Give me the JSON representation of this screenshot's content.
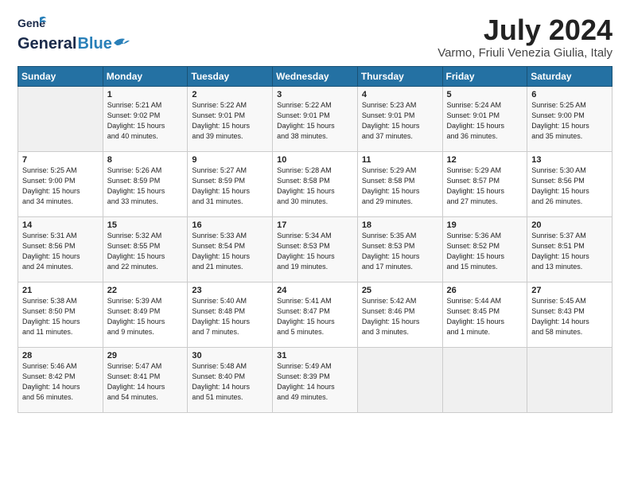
{
  "header": {
    "logo_general": "General",
    "logo_blue": "Blue",
    "title": "July 2024",
    "location": "Varmo, Friuli Venezia Giulia, Italy"
  },
  "days_of_week": [
    "Sunday",
    "Monday",
    "Tuesday",
    "Wednesday",
    "Thursday",
    "Friday",
    "Saturday"
  ],
  "weeks": [
    [
      {
        "day": "",
        "info": ""
      },
      {
        "day": "1",
        "info": "Sunrise: 5:21 AM\nSunset: 9:02 PM\nDaylight: 15 hours\nand 40 minutes."
      },
      {
        "day": "2",
        "info": "Sunrise: 5:22 AM\nSunset: 9:01 PM\nDaylight: 15 hours\nand 39 minutes."
      },
      {
        "day": "3",
        "info": "Sunrise: 5:22 AM\nSunset: 9:01 PM\nDaylight: 15 hours\nand 38 minutes."
      },
      {
        "day": "4",
        "info": "Sunrise: 5:23 AM\nSunset: 9:01 PM\nDaylight: 15 hours\nand 37 minutes."
      },
      {
        "day": "5",
        "info": "Sunrise: 5:24 AM\nSunset: 9:01 PM\nDaylight: 15 hours\nand 36 minutes."
      },
      {
        "day": "6",
        "info": "Sunrise: 5:25 AM\nSunset: 9:00 PM\nDaylight: 15 hours\nand 35 minutes."
      }
    ],
    [
      {
        "day": "7",
        "info": "Sunrise: 5:25 AM\nSunset: 9:00 PM\nDaylight: 15 hours\nand 34 minutes."
      },
      {
        "day": "8",
        "info": "Sunrise: 5:26 AM\nSunset: 8:59 PM\nDaylight: 15 hours\nand 33 minutes."
      },
      {
        "day": "9",
        "info": "Sunrise: 5:27 AM\nSunset: 8:59 PM\nDaylight: 15 hours\nand 31 minutes."
      },
      {
        "day": "10",
        "info": "Sunrise: 5:28 AM\nSunset: 8:58 PM\nDaylight: 15 hours\nand 30 minutes."
      },
      {
        "day": "11",
        "info": "Sunrise: 5:29 AM\nSunset: 8:58 PM\nDaylight: 15 hours\nand 29 minutes."
      },
      {
        "day": "12",
        "info": "Sunrise: 5:29 AM\nSunset: 8:57 PM\nDaylight: 15 hours\nand 27 minutes."
      },
      {
        "day": "13",
        "info": "Sunrise: 5:30 AM\nSunset: 8:56 PM\nDaylight: 15 hours\nand 26 minutes."
      }
    ],
    [
      {
        "day": "14",
        "info": "Sunrise: 5:31 AM\nSunset: 8:56 PM\nDaylight: 15 hours\nand 24 minutes."
      },
      {
        "day": "15",
        "info": "Sunrise: 5:32 AM\nSunset: 8:55 PM\nDaylight: 15 hours\nand 22 minutes."
      },
      {
        "day": "16",
        "info": "Sunrise: 5:33 AM\nSunset: 8:54 PM\nDaylight: 15 hours\nand 21 minutes."
      },
      {
        "day": "17",
        "info": "Sunrise: 5:34 AM\nSunset: 8:53 PM\nDaylight: 15 hours\nand 19 minutes."
      },
      {
        "day": "18",
        "info": "Sunrise: 5:35 AM\nSunset: 8:53 PM\nDaylight: 15 hours\nand 17 minutes."
      },
      {
        "day": "19",
        "info": "Sunrise: 5:36 AM\nSunset: 8:52 PM\nDaylight: 15 hours\nand 15 minutes."
      },
      {
        "day": "20",
        "info": "Sunrise: 5:37 AM\nSunset: 8:51 PM\nDaylight: 15 hours\nand 13 minutes."
      }
    ],
    [
      {
        "day": "21",
        "info": "Sunrise: 5:38 AM\nSunset: 8:50 PM\nDaylight: 15 hours\nand 11 minutes."
      },
      {
        "day": "22",
        "info": "Sunrise: 5:39 AM\nSunset: 8:49 PM\nDaylight: 15 hours\nand 9 minutes."
      },
      {
        "day": "23",
        "info": "Sunrise: 5:40 AM\nSunset: 8:48 PM\nDaylight: 15 hours\nand 7 minutes."
      },
      {
        "day": "24",
        "info": "Sunrise: 5:41 AM\nSunset: 8:47 PM\nDaylight: 15 hours\nand 5 minutes."
      },
      {
        "day": "25",
        "info": "Sunrise: 5:42 AM\nSunset: 8:46 PM\nDaylight: 15 hours\nand 3 minutes."
      },
      {
        "day": "26",
        "info": "Sunrise: 5:44 AM\nSunset: 8:45 PM\nDaylight: 15 hours\nand 1 minute."
      },
      {
        "day": "27",
        "info": "Sunrise: 5:45 AM\nSunset: 8:43 PM\nDaylight: 14 hours\nand 58 minutes."
      }
    ],
    [
      {
        "day": "28",
        "info": "Sunrise: 5:46 AM\nSunset: 8:42 PM\nDaylight: 14 hours\nand 56 minutes."
      },
      {
        "day": "29",
        "info": "Sunrise: 5:47 AM\nSunset: 8:41 PM\nDaylight: 14 hours\nand 54 minutes."
      },
      {
        "day": "30",
        "info": "Sunrise: 5:48 AM\nSunset: 8:40 PM\nDaylight: 14 hours\nand 51 minutes."
      },
      {
        "day": "31",
        "info": "Sunrise: 5:49 AM\nSunset: 8:39 PM\nDaylight: 14 hours\nand 49 minutes."
      },
      {
        "day": "",
        "info": ""
      },
      {
        "day": "",
        "info": ""
      },
      {
        "day": "",
        "info": ""
      }
    ]
  ]
}
